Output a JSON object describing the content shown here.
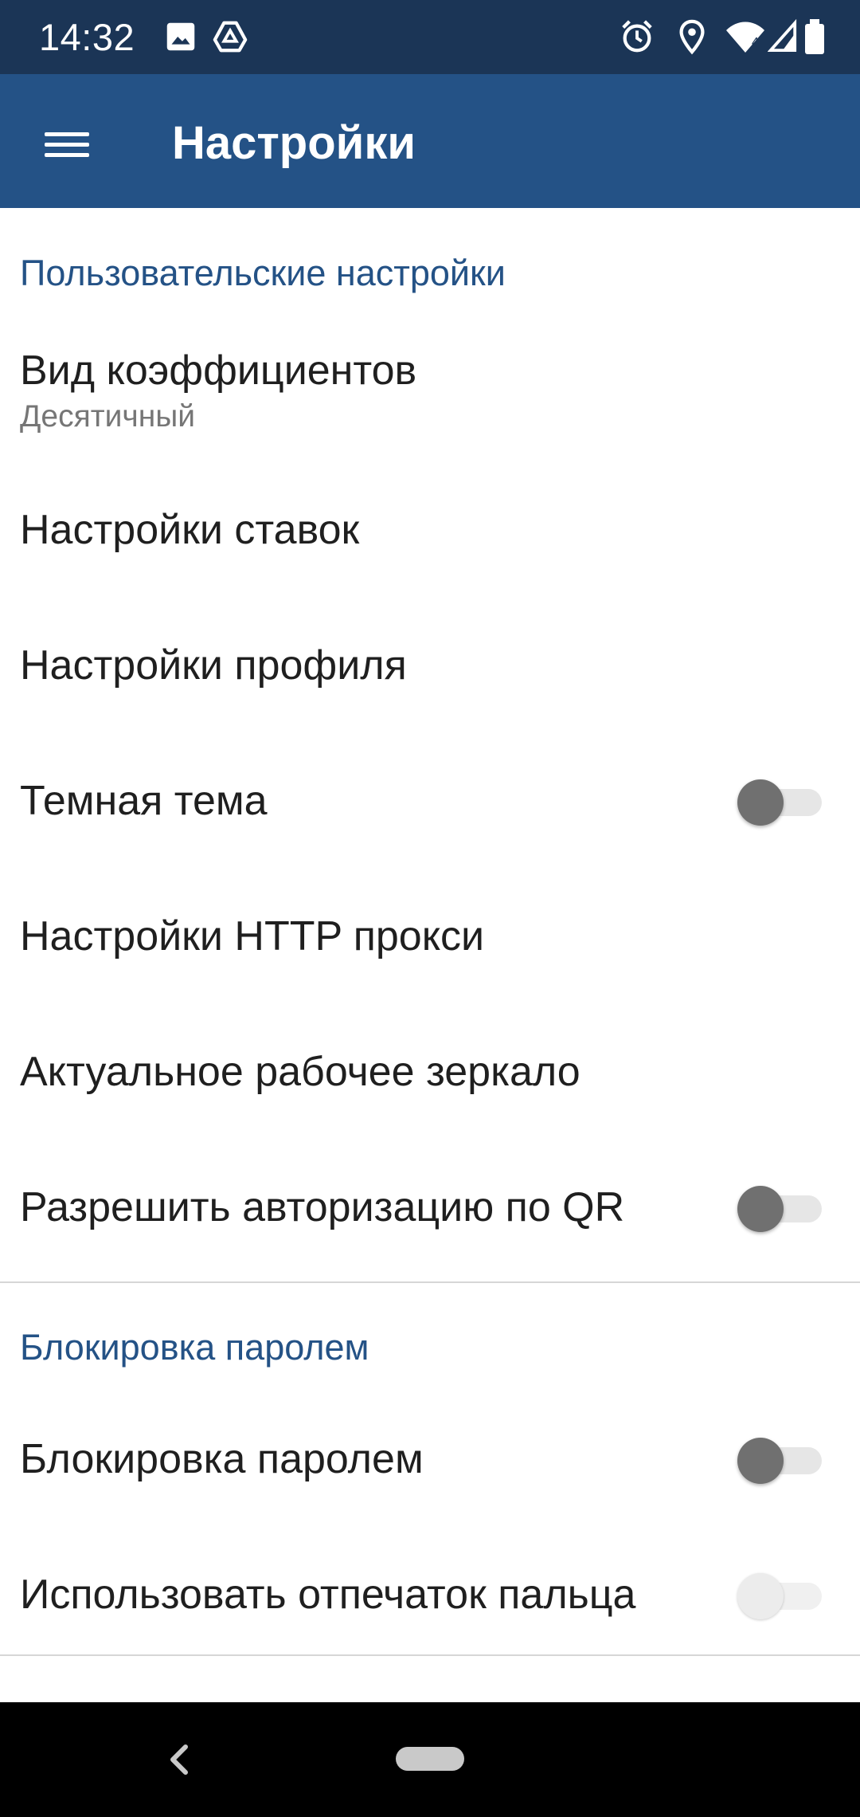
{
  "status_bar": {
    "time": "14:32",
    "left_icons": [
      "image-icon",
      "drive-icon"
    ],
    "right_icons": [
      "alarm-icon",
      "location-icon",
      "wifi-icon",
      "signal-icon",
      "battery-icon"
    ],
    "wifi_badge": "4"
  },
  "app_bar": {
    "title": "Настройки",
    "menu_icon": "hamburger-menu-icon"
  },
  "sections": [
    {
      "header": "Пользовательские настройки",
      "items": [
        {
          "title": "Вид коэффициентов",
          "subtitle": "Десятичный"
        },
        {
          "title": "Настройки ставок"
        },
        {
          "title": "Настройки профиля"
        },
        {
          "title": "Темная тема",
          "toggle": false
        },
        {
          "title": "Настройки HTTP прокси"
        },
        {
          "title": "Актуальное рабочее зеркало"
        },
        {
          "title": "Разрешить авторизацию по QR",
          "toggle": false
        }
      ]
    },
    {
      "header": "Блокировка паролем",
      "items": [
        {
          "title": "Блокировка паролем",
          "toggle": false
        },
        {
          "title": "Использовать отпечаток пальца",
          "toggle": false,
          "disabled": true
        }
      ]
    }
  ],
  "nav_bar": {
    "back_icon": "back-chevron-icon",
    "home_icon": "home-pill-icon"
  },
  "colors": {
    "status_bar": "#1b3556",
    "app_bar": "#245286",
    "accent": "#245286",
    "toggle_thumb_off": "#707070"
  }
}
